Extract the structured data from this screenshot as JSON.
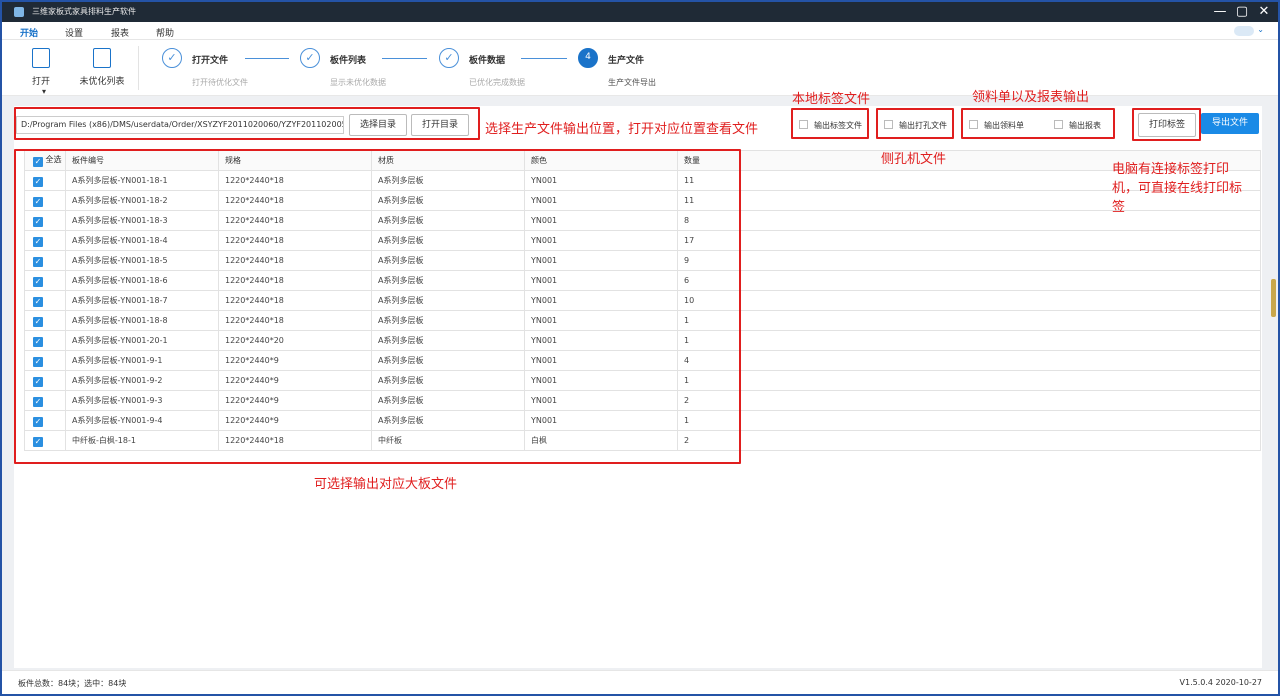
{
  "window": {
    "title": "三维家板式家具排料生产软件",
    "minimize": "—",
    "restore": "▢",
    "close": "✕"
  },
  "menu": {
    "items": [
      "开始",
      "设置",
      "报表",
      "帮助"
    ]
  },
  "toolbar": {
    "open_label": "打开",
    "unoptimized_label": "未优化列表"
  },
  "steps": [
    {
      "mark": "✓",
      "name": "打开文件",
      "desc": "打开待优化文件"
    },
    {
      "mark": "✓",
      "name": "板件列表",
      "desc": "显示未优化数据"
    },
    {
      "mark": "✓",
      "name": "板件数据",
      "desc": "已优化完成数据"
    },
    {
      "mark": "4",
      "name": "生产文件",
      "desc": "生产文件导出"
    }
  ],
  "output": {
    "path": "D:/Program Files (x86)/DMS/userdata/Order/XSYZYF2011020060/YZYF2011020055",
    "select_dir": "选择目录",
    "open_dir": "打开目录"
  },
  "options": {
    "label_file": "输出标签文件",
    "drill_file": "输出打孔文件",
    "material_list": "输出领料单",
    "report": "输出报表"
  },
  "buttons": {
    "print_label": "打印标签",
    "export_file": "导出文件"
  },
  "annotations": {
    "path_note": "选择生产文件输出位置，打开对应位置查看文件",
    "label_note": "本地标签文件",
    "drill_note": "侧孔机文件",
    "material_note": "领料单以及报表输出",
    "printer_note_1": "电脑有连接标签打印",
    "printer_note_2": "机，可直接在线打印标",
    "printer_note_3": "签",
    "table_note": "可选择输出对应大板文件"
  },
  "table": {
    "select_all": "全选",
    "columns": [
      "板件编号",
      "规格",
      "材质",
      "颜色",
      "数量"
    ],
    "rows": [
      [
        "A系列多层板-YN001-18-1",
        "1220*2440*18",
        "A系列多层板",
        "YN001",
        "11"
      ],
      [
        "A系列多层板-YN001-18-2",
        "1220*2440*18",
        "A系列多层板",
        "YN001",
        "11"
      ],
      [
        "A系列多层板-YN001-18-3",
        "1220*2440*18",
        "A系列多层板",
        "YN001",
        "8"
      ],
      [
        "A系列多层板-YN001-18-4",
        "1220*2440*18",
        "A系列多层板",
        "YN001",
        "17"
      ],
      [
        "A系列多层板-YN001-18-5",
        "1220*2440*18",
        "A系列多层板",
        "YN001",
        "9"
      ],
      [
        "A系列多层板-YN001-18-6",
        "1220*2440*18",
        "A系列多层板",
        "YN001",
        "6"
      ],
      [
        "A系列多层板-YN001-18-7",
        "1220*2440*18",
        "A系列多层板",
        "YN001",
        "10"
      ],
      [
        "A系列多层板-YN001-18-8",
        "1220*2440*18",
        "A系列多层板",
        "YN001",
        "1"
      ],
      [
        "A系列多层板-YN001-20-1",
        "1220*2440*20",
        "A系列多层板",
        "YN001",
        "1"
      ],
      [
        "A系列多层板-YN001-9-1",
        "1220*2440*9",
        "A系列多层板",
        "YN001",
        "4"
      ],
      [
        "A系列多层板-YN001-9-2",
        "1220*2440*9",
        "A系列多层板",
        "YN001",
        "1"
      ],
      [
        "A系列多层板-YN001-9-3",
        "1220*2440*9",
        "A系列多层板",
        "YN001",
        "2"
      ],
      [
        "A系列多层板-YN001-9-4",
        "1220*2440*9",
        "A系列多层板",
        "YN001",
        "1"
      ],
      [
        "中纤板-白枫-18-1",
        "1220*2440*18",
        "中纤板",
        "白枫",
        "2"
      ]
    ]
  },
  "status": {
    "left": "板件总数：84块；选中：84块",
    "right": "V1.5.0.4 2020-10-27"
  }
}
